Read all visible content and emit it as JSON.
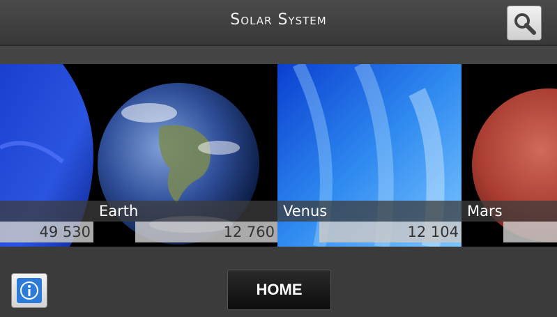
{
  "header": {
    "title": "Solar System"
  },
  "planets": [
    {
      "name": "",
      "value": "49 530"
    },
    {
      "name": "Earth",
      "value": "12 760"
    },
    {
      "name": "Venus",
      "value": "12 104"
    },
    {
      "name": "Mars",
      "value": ""
    }
  ],
  "footer": {
    "home_label": "HOME"
  },
  "colors": {
    "bar": "#3b3b3b",
    "accent": "#2d7bd8"
  }
}
